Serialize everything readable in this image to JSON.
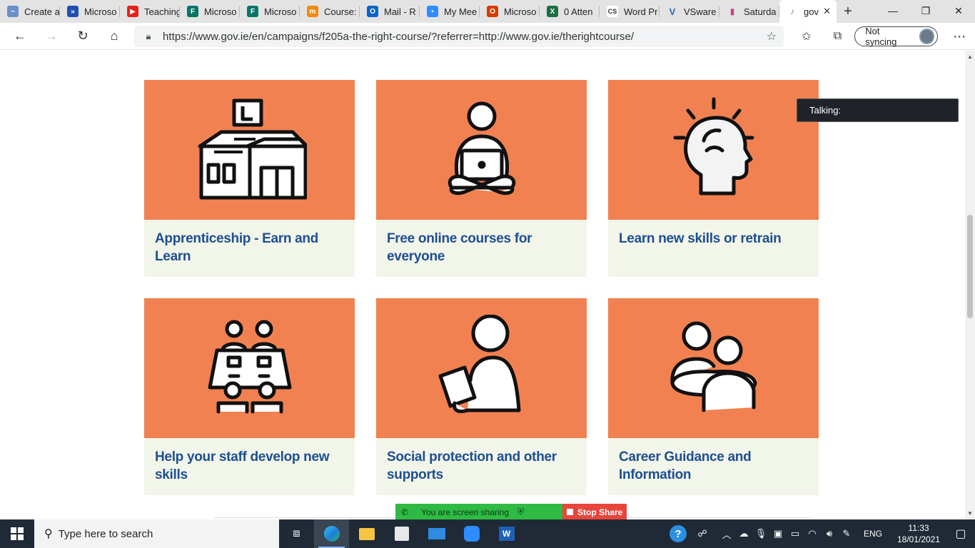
{
  "browser": {
    "tabs": [
      {
        "title": "Create a",
        "icon": "app-icon",
        "color": "#6a8ec8"
      },
      {
        "title": "Microso",
        "icon": "power-automate-icon",
        "color": "#1f4fb4"
      },
      {
        "title": "Teaching",
        "icon": "youtube-icon",
        "color": "#e62117"
      },
      {
        "title": "Microso",
        "icon": "forms-icon",
        "color": "#077568"
      },
      {
        "title": "Microso",
        "icon": "forms-icon",
        "color": "#077568"
      },
      {
        "title": "Course:",
        "icon": "moodle-icon",
        "color": "#f28a0e"
      },
      {
        "title": "Mail - R",
        "icon": "outlook-icon",
        "color": "#0a64c8"
      },
      {
        "title": "My Mee",
        "icon": "zoom-icon",
        "color": "#2d8cff"
      },
      {
        "title": "Microso",
        "icon": "office-icon",
        "color": "#d83b01"
      },
      {
        "title": "0 Atten",
        "icon": "excel-icon",
        "color": "#1d6f42"
      },
      {
        "title": "Word Pr",
        "icon": "cs-icon",
        "color": "#333333"
      },
      {
        "title": "VSware",
        "icon": "vsware-icon",
        "color": "#2a66b8"
      },
      {
        "title": "Saturda",
        "icon": "chart-icon",
        "color": "#c04a8a"
      }
    ],
    "active_tab": {
      "title": "gov",
      "icon": "harp-icon"
    },
    "url": "https://www.gov.ie/en/campaigns/f205a-the-right-course/?referrer=http://www.gov.ie/therightcourse/",
    "sync_label": "Not syncing"
  },
  "cards": [
    {
      "title": "Apprenticeship - Earn and Learn",
      "icon": "apprenticeship-building-icon"
    },
    {
      "title": "Free online courses for everyone",
      "icon": "person-laptop-icon"
    },
    {
      "title": "Learn new skills or retrain",
      "icon": "head-lightbulb-icon"
    },
    {
      "title": "Help your staff develop new skills",
      "icon": "staff-meeting-table-icon"
    },
    {
      "title": "Social protection and other supports",
      "icon": "person-reading-icon"
    },
    {
      "title": "Career Guidance and Information",
      "icon": "guidance-people-icon"
    }
  ],
  "overlay": {
    "talking": "Talking:"
  },
  "share": {
    "status": "You are screen sharing",
    "stop": "Stop Share"
  },
  "taskbar": {
    "search_placeholder": "Type here to search",
    "lang": "ENG",
    "time": "11:33",
    "date": "18/01/2021"
  },
  "colors": {
    "tile": "#f28151",
    "card_bg": "#f2f5e9",
    "link": "#1d4f91"
  }
}
